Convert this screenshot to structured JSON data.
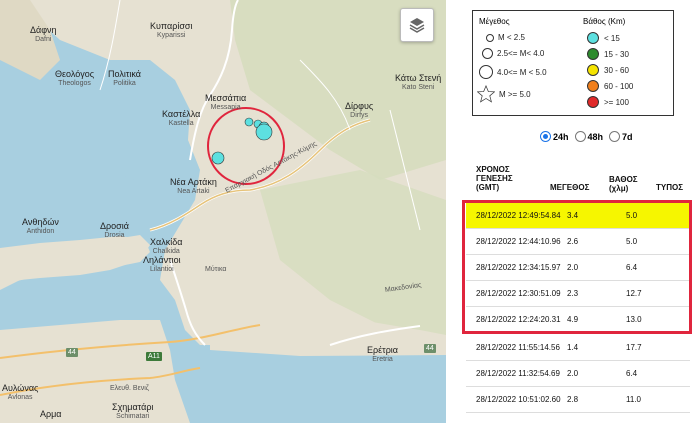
{
  "map": {
    "places": [
      {
        "name": "Δάφνη",
        "latin": "Dafni"
      },
      {
        "name": "Κυπαρίσσι",
        "latin": "Kyparissi"
      },
      {
        "name": "Θεολόγος",
        "latin": "Theologos"
      },
      {
        "name": "Πολιτικά",
        "latin": "Politika"
      },
      {
        "name": "Κάτω Στενή",
        "latin": "Kato Steni"
      },
      {
        "name": "Μεσσάπια",
        "latin": "Messapia"
      },
      {
        "name": "Καστέλλα",
        "latin": "Kastella"
      },
      {
        "name": "Δίρφυς",
        "latin": "Dirfys"
      },
      {
        "name": "Νέα Αρτάκη",
        "latin": "Nea Artaki"
      },
      {
        "name": "Ανθηδών",
        "latin": "Anthidon"
      },
      {
        "name": "Δροσιά",
        "latin": "Drosia"
      },
      {
        "name": "Χαλκίδα",
        "latin": "Chalkida"
      },
      {
        "name": "Ληλάντιοι",
        "latin": "Lilantioi"
      },
      {
        "name": "Ερέτρια",
        "latin": "Eretria"
      },
      {
        "name": "Αυλώνας",
        "latin": "Avlonas"
      },
      {
        "name": "Σχηματάρι",
        "latin": "Schimatari"
      },
      {
        "name": "Αρμα",
        "latin": "Arma"
      }
    ],
    "road_labels": {
      "main": "Επαρχιακή Οδός Αρτάκης-Κύμης",
      "mytika": "Μύτικα",
      "makedonias": "Μακεδονίας",
      "eleftherios": "Ελευθ. Βενιζ"
    },
    "road_badges": [
      "44",
      "Α11",
      "44"
    ],
    "layers_icon": "layers-icon"
  },
  "legend": {
    "magnitude_title": "Μέγεθος",
    "depth_title": "Βάθος (Km)",
    "magnitude": [
      "M < 2.5",
      "2.5<= M< 4.0",
      "4.0<= M < 5.0",
      "M >= 5.0"
    ],
    "depth": [
      {
        "label": "< 15",
        "color": "#5de0e0"
      },
      {
        "label": "15 - 30",
        "color": "#2e8b2e"
      },
      {
        "label": "30 - 60",
        "color": "#f5e400"
      },
      {
        "label": "60 - 100",
        "color": "#f07f1c"
      },
      {
        "label": ">= 100",
        "color": "#e02a2a"
      }
    ]
  },
  "period": {
    "options": [
      "24h",
      "48h",
      "7d"
    ],
    "selected": "24h"
  },
  "table": {
    "headers": {
      "time": "ΧΡΟΝΟΣ\nΓΕΝΕΣΗΣ\n(GMT)",
      "magnitude": "ΜΕΓΕΘΟΣ",
      "depth": "ΒΑΘΟΣ\n(χλμ)",
      "type": "ΤΥΠΟΣ"
    },
    "rows": [
      {
        "time": "28/12/2022 12:49:54.84",
        "mag": "3.4",
        "depth": "5.0",
        "type": ""
      },
      {
        "time": "28/12/2022 12:44:10.96",
        "mag": "2.6",
        "depth": "5.0",
        "type": ""
      },
      {
        "time": "28/12/2022 12:34:15.97",
        "mag": "2.0",
        "depth": "6.4",
        "type": ""
      },
      {
        "time": "28/12/2022 12:30:51.09",
        "mag": "2.3",
        "depth": "12.7",
        "type": ""
      },
      {
        "time": "28/12/2022 12:24:20.31",
        "mag": "4.9",
        "depth": "13.0",
        "type": ""
      },
      {
        "time": "28/12/2022 11:55:14.56",
        "mag": "1.4",
        "depth": "17.7",
        "type": ""
      },
      {
        "time": "28/12/2022 11:32:54.69",
        "mag": "2.0",
        "depth": "6.4",
        "type": ""
      },
      {
        "time": "28/12/2022 10:51:02.60",
        "mag": "2.8",
        "depth": "11.0",
        "type": ""
      }
    ],
    "highlight_row": 0
  },
  "colors": {
    "highlight": "#f6f600",
    "alert_box": "#e0253d",
    "quake_fill": "#5de0e0",
    "circle": "#e0253d"
  }
}
